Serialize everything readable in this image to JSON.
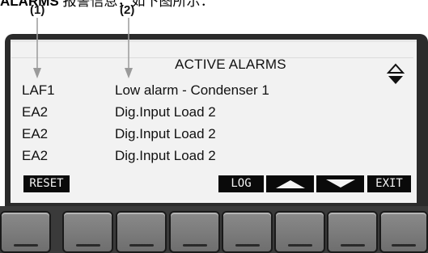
{
  "caption": {
    "bold": "ALARMS",
    "rest": " 报警信息，如下图所示："
  },
  "callouts": [
    "(1)",
    "(2)"
  ],
  "screen": {
    "title": "ACTIVE ALARMS",
    "rows": [
      {
        "code": "LAF1",
        "desc": "Low alarm - Condenser 1"
      },
      {
        "code": "EA2",
        "desc": "Dig.Input Load 2"
      },
      {
        "code": "EA2",
        "desc": "Dig.Input Load 2"
      },
      {
        "code": "EA2",
        "desc": "Dig.Input Load 2"
      }
    ],
    "softkeys": {
      "reset": "RESET",
      "log": "LOG",
      "exit": "EXIT"
    }
  },
  "icons": {
    "scroll": "up-down-scroll-icon",
    "up": "up-triangle-icon",
    "down": "down-triangle-icon"
  }
}
